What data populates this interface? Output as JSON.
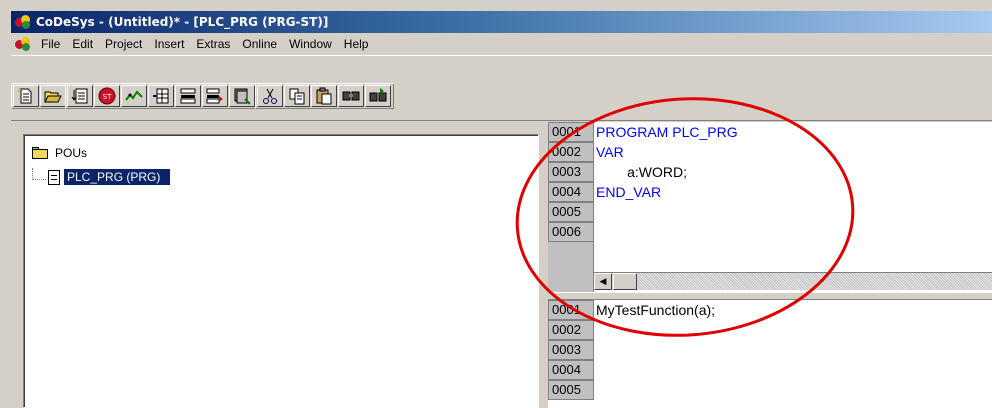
{
  "window": {
    "title": "CoDeSys - (Untitled)* - [PLC_PRG (PRG-ST)]"
  },
  "menu": [
    "File",
    "Edit",
    "Project",
    "Insert",
    "Extras",
    "Online",
    "Window",
    "Help"
  ],
  "toolbar": {
    "group1": [
      "new-icon",
      "open-icon",
      "save-icon"
    ],
    "group2": [
      "build-icon",
      "stop-icon",
      "step-icon",
      "grid-icon",
      "run-icon",
      "login-icon",
      "debug-icon"
    ],
    "group3": [
      "cut-icon",
      "copy-icon",
      "paste-icon",
      "find-icon",
      "find-next-icon"
    ]
  },
  "tree": {
    "root_label": "POUs",
    "child_label": "PLC_PRG (PRG)"
  },
  "declaration": [
    {
      "num": "0001",
      "code": "PROGRAM PLC_PRG"
    },
    {
      "num": "0002",
      "code": "VAR"
    },
    {
      "num": "0003",
      "code": "        a:WORD;"
    },
    {
      "num": "0004",
      "code": "END_VAR"
    },
    {
      "num": "0005",
      "code": ""
    },
    {
      "num": "0006",
      "code": ""
    }
  ],
  "body": [
    {
      "num": "0001",
      "code": "MyTestFunction(a);"
    },
    {
      "num": "0002",
      "code": ""
    },
    {
      "num": "0003",
      "code": ""
    },
    {
      "num": "0004",
      "code": ""
    },
    {
      "num": "0005",
      "code": ""
    }
  ],
  "colors": {
    "titlebar": "#0a246a",
    "keyword": "#0000ff",
    "annotation": "#e00000",
    "selection": "#0a246a"
  }
}
